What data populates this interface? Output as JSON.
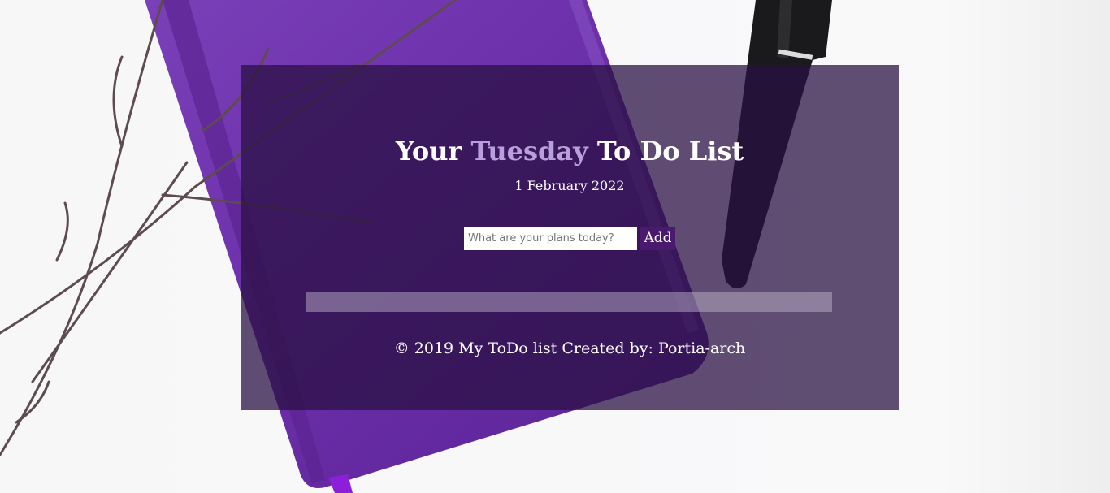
{
  "header": {
    "title_prefix": "Your",
    "title_day": "Tuesday",
    "title_suffix": "To Do List",
    "date": "1 February 2022"
  },
  "form": {
    "input_placeholder": "What are your plans today?",
    "input_value": "",
    "add_label": "Add"
  },
  "task_list": {
    "items": []
  },
  "footer": {
    "text": "© 2019 My ToDo list Created by: Portia-arch"
  },
  "colors": {
    "panel_overlay": "#2a1042",
    "day_accent": "#b9a0dc",
    "add_button": "#4a1a6e",
    "text": "#ffffff"
  },
  "background": {
    "description_icon": "notebook-pen-branch-photo"
  }
}
